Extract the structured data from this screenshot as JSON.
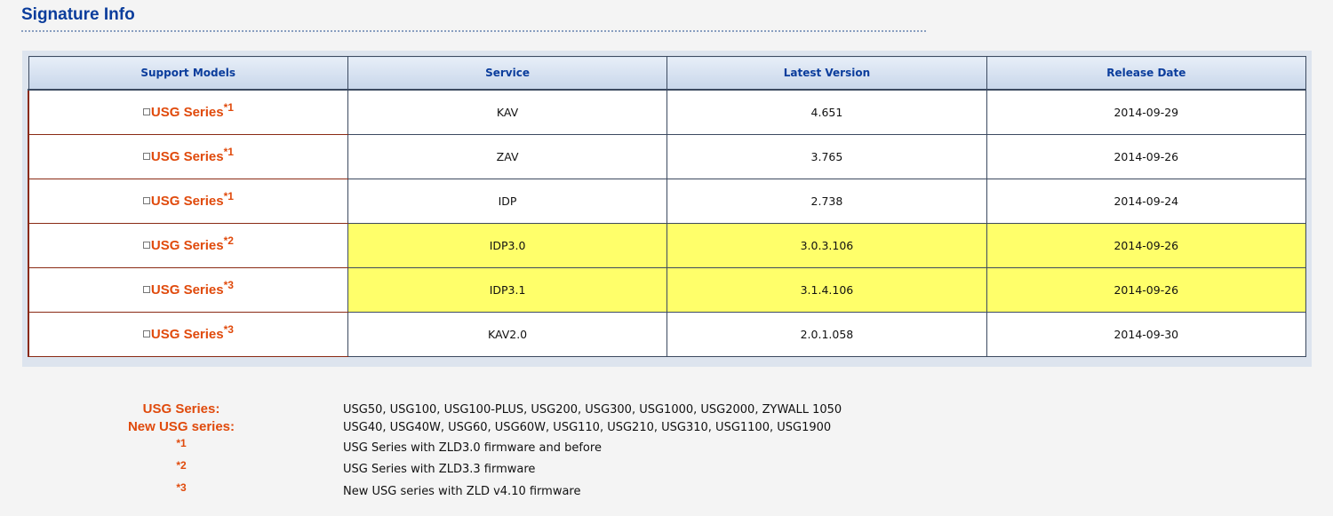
{
  "page": {
    "title": "Signature Info"
  },
  "table": {
    "headers": [
      "Support Models",
      "Service",
      "Latest Version",
      "Release Date"
    ],
    "rows": [
      {
        "model": "USG Series",
        "mark": "*1",
        "service": "KAV",
        "version": "4.651",
        "date": "2014-09-29",
        "highlight": false
      },
      {
        "model": "USG Series",
        "mark": "*1",
        "service": "ZAV",
        "version": "3.765",
        "date": "2014-09-26",
        "highlight": false
      },
      {
        "model": "USG Series",
        "mark": "*1",
        "service": "IDP",
        "version": "2.738",
        "date": "2014-09-24",
        "highlight": false
      },
      {
        "model": "USG Series",
        "mark": "*2",
        "service": "IDP3.0",
        "version": "3.0.3.106",
        "date": "2014-09-26",
        "highlight": true
      },
      {
        "model": "USG Series",
        "mark": "*3",
        "service": "IDP3.1",
        "version": "3.1.4.106",
        "date": "2014-09-26",
        "highlight": true
      },
      {
        "model": "USG Series",
        "mark": "*3",
        "service": "KAV2.0",
        "version": "2.0.1.058",
        "date": "2014-09-30",
        "highlight": false
      }
    ],
    "highlight_color": "#ffff6a"
  },
  "legend": [
    {
      "key": "USG Series:",
      "value": "USG50, USG100, USG100-PLUS, USG200, USG300, USG1000, USG2000, ZYWALL 1050"
    },
    {
      "key": "New USG series:",
      "value": "USG40, USG40W, USG60, USG60W, USG110, USG210, USG310, USG1100, USG1900"
    },
    {
      "key": "*1",
      "value": "USG Series with ZLD3.0 firmware and before"
    },
    {
      "key": "*2",
      "value": "USG Series with ZLD3.3 firmware"
    },
    {
      "key": "*3",
      "value": "New USG series with ZLD v4.10 firmware"
    }
  ],
  "colors": {
    "title": "#0b3d9c",
    "accent": "#e04a0c",
    "background": "#f4f4f4"
  }
}
